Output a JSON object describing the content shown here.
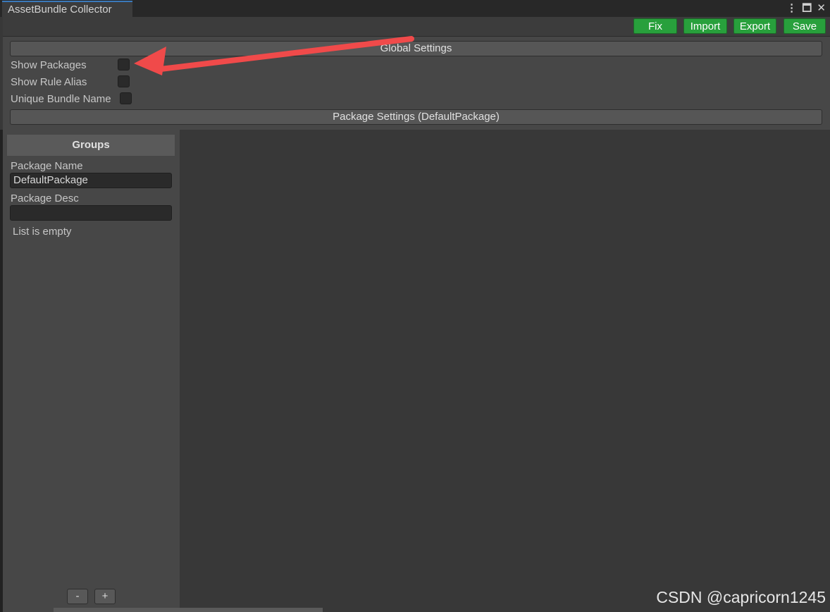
{
  "window": {
    "tab_title": "AssetBundle Collector"
  },
  "window_controls": {
    "menu_icon": "⋮",
    "maximize_icon": "🗖",
    "close_icon": "✕"
  },
  "toolbar": {
    "buttons": [
      {
        "label": "Fix"
      },
      {
        "label": "Import"
      },
      {
        "label": "Export"
      },
      {
        "label": "Save"
      }
    ]
  },
  "global_settings": {
    "header": "Global Settings",
    "options": [
      {
        "label": "Show Packages",
        "checked": false
      },
      {
        "label": "Show Rule Alias",
        "checked": false
      },
      {
        "label": "Unique Bundle Name",
        "checked": false
      }
    ]
  },
  "package_settings": {
    "header": "Package Settings (DefaultPackage)"
  },
  "groups_panel": {
    "header": "Groups",
    "package_name_label": "Package Name",
    "package_name_value": "DefaultPackage",
    "package_desc_label": "Package Desc",
    "package_desc_value": "",
    "empty_text": "List is empty",
    "remove_label": "-",
    "add_label": "+"
  },
  "watermark": {
    "text": "CSDN @capricorn1245"
  },
  "annotation": {
    "arrow_color": "#f04a4a"
  }
}
